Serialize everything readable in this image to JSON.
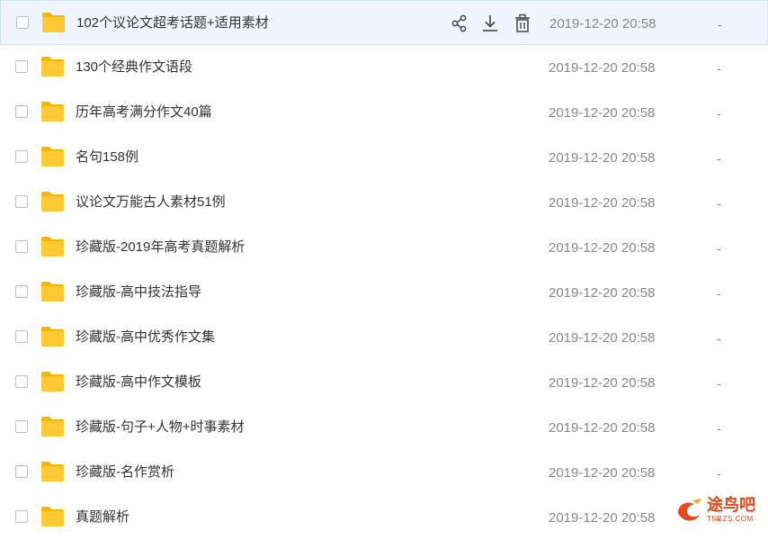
{
  "files": [
    {
      "name": "102个议论文超考话题+适用素材",
      "date": "2019-12-20 20:58",
      "size": "-"
    },
    {
      "name": "130个经典作文语段",
      "date": "2019-12-20 20:58",
      "size": "-"
    },
    {
      "name": "历年高考满分作文40篇",
      "date": "2019-12-20 20:58",
      "size": "-"
    },
    {
      "name": "名句158例",
      "date": "2019-12-20 20:58",
      "size": "-"
    },
    {
      "name": "议论文万能古人素材51例",
      "date": "2019-12-20 20:58",
      "size": "-"
    },
    {
      "name": "珍藏版-2019年高考真题解析",
      "date": "2019-12-20 20:58",
      "size": "-"
    },
    {
      "name": "珍藏版-高中技法指导",
      "date": "2019-12-20 20:58",
      "size": "-"
    },
    {
      "name": "珍藏版-高中优秀作文集",
      "date": "2019-12-20 20:58",
      "size": "-"
    },
    {
      "name": "珍藏版-高中作文模板",
      "date": "2019-12-20 20:58",
      "size": "-"
    },
    {
      "name": "珍藏版-句子+人物+时事素材",
      "date": "2019-12-20 20:58",
      "size": "-"
    },
    {
      "name": "珍藏版-名作赏析",
      "date": "2019-12-20 20:58",
      "size": "-"
    },
    {
      "name": "真题解析",
      "date": "2019-12-20 20:58",
      "size": "-"
    }
  ],
  "row_actions": [
    {
      "icon": "share-icon"
    },
    {
      "icon": "download-icon"
    },
    {
      "icon": "delete-icon"
    }
  ],
  "hover_row_index": 0,
  "colors": {
    "folder": "#ffc933",
    "hover_bg": "#eef5fe",
    "text": "#333333",
    "muted": "#888888"
  },
  "watermark": {
    "text": "途鸟吧",
    "sub": "TNBZS.COM"
  }
}
